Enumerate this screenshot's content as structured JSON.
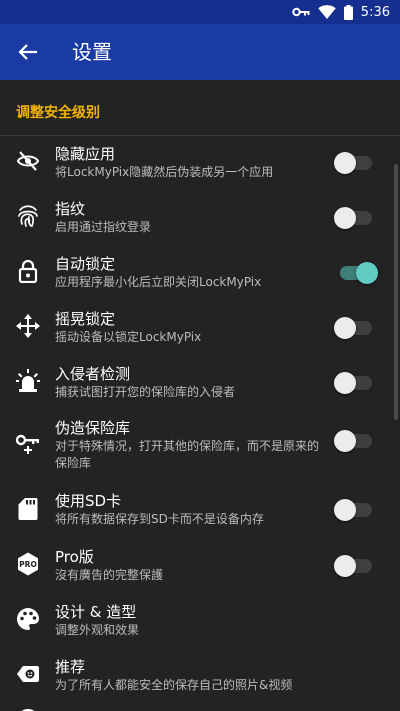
{
  "status_bar": {
    "time": "5:36",
    "icons": [
      "key-icon",
      "wifi-icon",
      "battery-icon"
    ]
  },
  "app_bar": {
    "title": "设置",
    "back_icon": "arrow-left-icon"
  },
  "section": {
    "label": "调整安全级别"
  },
  "colors": {
    "app_bar": "#1a3aa4",
    "status_bar": "#142f8f",
    "accent": "#f3b400",
    "toggle_on": "#62cbc4",
    "background": "#232323"
  },
  "settings": [
    {
      "icon": "eye-off-icon",
      "title": "隐藏应用",
      "subtitle": "将LockMyPix隐藏然后伪装成另一个应用",
      "toggle": false
    },
    {
      "icon": "fingerprint-icon",
      "title": "指纹",
      "subtitle": "启用通过指纹登录",
      "toggle": false
    },
    {
      "icon": "lock-icon",
      "title": "自动锁定",
      "subtitle": "应用程序最小化后立即关闭LockMyPix",
      "toggle": true
    },
    {
      "icon": "move-icon",
      "title": "摇晃锁定",
      "subtitle": "摇动设备以锁定LockMyPix",
      "toggle": false
    },
    {
      "icon": "alarm-light-icon",
      "title": "入侵者检测",
      "subtitle": "捕获试图打开您的保险库的入侵者",
      "toggle": false
    },
    {
      "icon": "key-plus-icon",
      "title": "伪造保险库",
      "subtitle": "对于特殊情况，打开其他的保险库，而不是原来的保险库",
      "toggle": false
    },
    {
      "icon": "sd-card-icon",
      "title": "使用SD卡",
      "subtitle": "将所有数据保存到SD卡而不是设备内存",
      "toggle": false
    },
    {
      "icon": "pro-badge-icon",
      "title": "Pro版",
      "subtitle": "沒有廣告的完整保護",
      "toggle": false
    },
    {
      "icon": "palette-icon",
      "title": "设计 & 造型",
      "subtitle": "调整外观和效果"
    },
    {
      "icon": "recommend-icon",
      "title": "推荐",
      "subtitle": "为了所有人都能安全的保存自己的照片&视频"
    }
  ]
}
